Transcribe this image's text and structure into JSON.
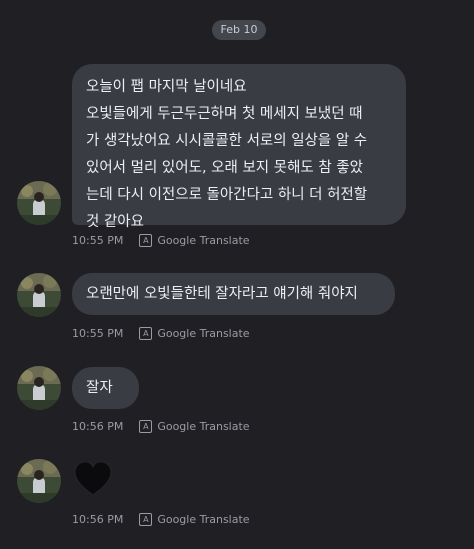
{
  "date_separator": "Feb 10",
  "messages": [
    {
      "lines": [
        "오늘이 팹 마지막 날이네요",
        "오빛들에게 두근두근하며 첫 메세지 보냈던 때",
        "가 생각났어요 시시콜콜한 서로의 일상을 알 수",
        "있어서 멀리 있어도, 오래 보지 못해도 참 좋았",
        "는데 다시 이전으로 돌아간다고 하니 더 허전할",
        "것 같아요"
      ],
      "time": "10:55 PM",
      "translate_label": "Google Translate",
      "translate_icon": "A"
    },
    {
      "text": "오랜만에 오빛들한테 잘자라고 얘기해 줘야지",
      "time": "10:55 PM",
      "translate_label": "Google Translate",
      "translate_icon": "A"
    },
    {
      "text": "잘자",
      "time": "10:56 PM",
      "translate_label": "Google Translate",
      "translate_icon": "A"
    },
    {
      "emoji": "black-heart-icon",
      "time": "10:56 PM",
      "translate_label": "Google Translate",
      "translate_icon": "A"
    }
  ],
  "colors": {
    "background": "#1f1f24",
    "bubble": "#3a3c44",
    "date_pill": "#44464e",
    "meta_text": "#9a9ca4"
  }
}
